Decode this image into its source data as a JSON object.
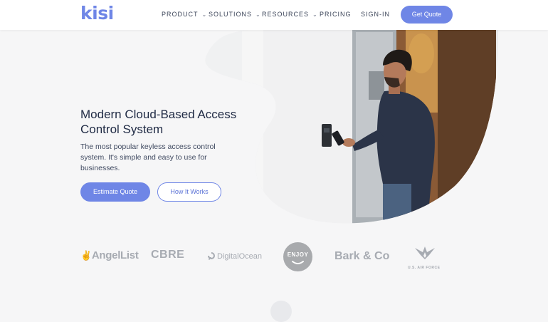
{
  "header": {
    "logo_text": "kisi",
    "nav": [
      {
        "label": "PRODUCT",
        "has_dropdown": true
      },
      {
        "label": "SOLUTIONS",
        "has_dropdown": true
      },
      {
        "label": "RESOURCES",
        "has_dropdown": true
      },
      {
        "label": "PRICING",
        "has_dropdown": false
      },
      {
        "label": "SIGN-IN",
        "has_dropdown": false
      }
    ],
    "cta_label": "Get Quote",
    "chevron_glyph": "⌄"
  },
  "hero": {
    "title": "Modern Cloud-Based Access Control System",
    "description": "The most popular keyless access control system. It's simple and easy to use for businesses.",
    "primary_button": "Estimate Quote",
    "secondary_button": "How It Works"
  },
  "client_logos": {
    "angellist": "AngelList",
    "cbre": "CBRE",
    "digitalocean": "DigitalOcean",
    "enjoy": "ENJOY",
    "bark": "Bark & Co",
    "airforce": "U.S. AIR FORCE"
  },
  "colors": {
    "accent": "#6f86e6",
    "background": "#f6f6f7",
    "text_dark": "#1f2a44",
    "logo_gray": "#a7abb2"
  }
}
